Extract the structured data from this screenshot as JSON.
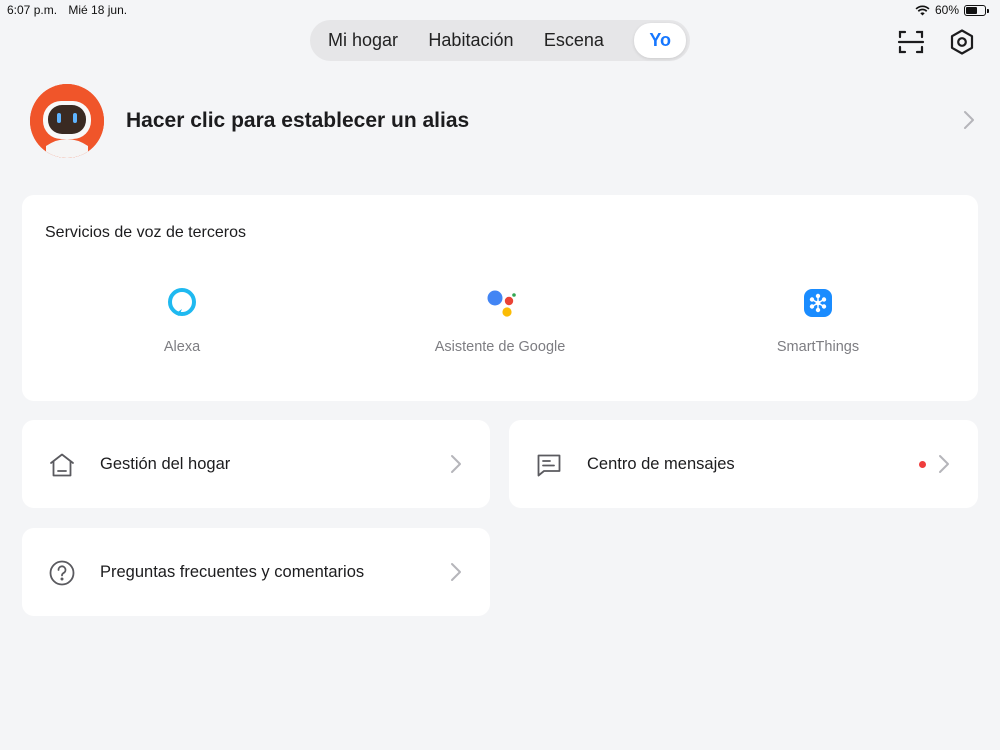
{
  "status_bar": {
    "time": "6:07 p.m.",
    "date": "Mié 18 jun.",
    "battery_percent": "60%",
    "battery_level": 0.6,
    "wifi": "wifi-icon"
  },
  "tabs": [
    {
      "label": "Mi hogar",
      "active": false
    },
    {
      "label": "Habitación",
      "active": false
    },
    {
      "label": "Escena",
      "active": false
    },
    {
      "label": "Yo",
      "active": true
    }
  ],
  "header_icons": {
    "scan": "scan-icon",
    "settings": "settings-hexagon-icon"
  },
  "profile": {
    "name_prompt": "Hacer clic para establecer un alias",
    "avatar": "robot-avatar"
  },
  "voice_services": {
    "title": "Servicios de voz de terceros",
    "items": [
      {
        "label": "Alexa",
        "icon": "alexa-icon",
        "color": "#1fb9f0"
      },
      {
        "label": "Asistente de Google",
        "icon": "google-assistant-icon",
        "color": "#4285f4"
      },
      {
        "label": "SmartThings",
        "icon": "smartthings-icon",
        "color": "#1a8cff"
      }
    ]
  },
  "menu": {
    "home_management": {
      "label": "Gestión del hogar",
      "icon": "home-icon"
    },
    "message_center": {
      "label": "Centro de mensajes",
      "icon": "message-icon",
      "has_unread": true
    },
    "faq": {
      "label": "Preguntas frecuentes y comentarios",
      "icon": "question-circle-icon"
    }
  },
  "colors": {
    "accent": "#1677ff",
    "background": "#f4f5f7",
    "unread_dot": "#ef3d3d",
    "avatar": "#f0552a"
  }
}
